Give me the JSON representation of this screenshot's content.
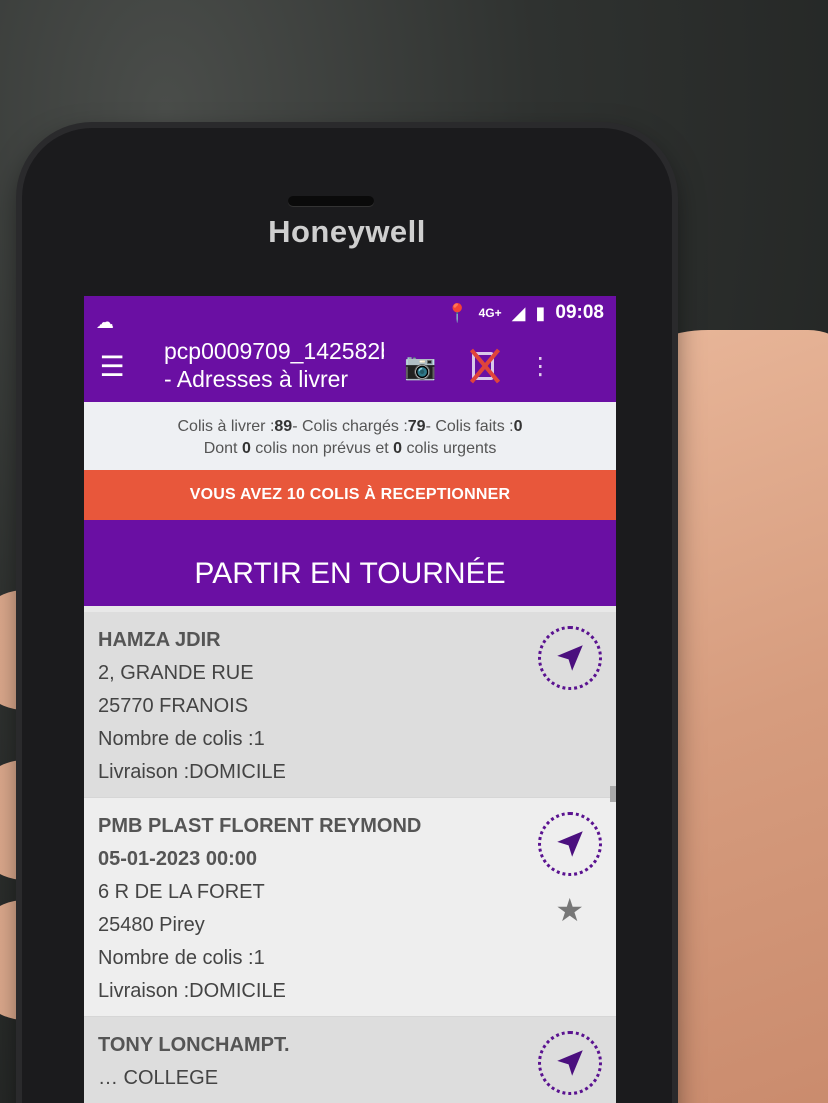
{
  "device": {
    "brand": "Honeywell"
  },
  "statusbar": {
    "network": "4G+",
    "time": "09:08"
  },
  "appbar": {
    "title": "pcp0009709_142582b - Adresses à livrer"
  },
  "summary": {
    "colis_a_livrer_label": "Colis à livrer :",
    "colis_a_livrer": "89",
    "colis_charges_label": "- Colis chargés :",
    "colis_charges": "79",
    "colis_faits_label": "- Colis faits :",
    "colis_faits": "0",
    "dont_label": "Dont ",
    "non_prevus": "0",
    "non_prevus_label": " colis non prévus et ",
    "urgents": "0",
    "urgents_label": " colis urgents"
  },
  "alert": {
    "text": "VOUS AVEZ 10 COLIS À RECEPTIONNER"
  },
  "depart_button": {
    "label": "PARTIR EN TOURNÉE"
  },
  "deliveries": [
    {
      "name": "HAMZA JDIR",
      "street": "2, GRANDE RUE",
      "city": "25770 FRANOIS",
      "count": "Nombre de colis :1",
      "delivery": "Livraison :DOMICILE"
    },
    {
      "name": "PMB PLAST FLORENT REYMOND",
      "date": "05-01-2023 00:00",
      "street": "6 R DE LA FORET",
      "city": "25480 Pirey",
      "count": "Nombre de colis :1",
      "delivery": "Livraison :DOMICILE"
    },
    {
      "name": "TONY LONCHAMPT.",
      "street": "… COLLEGE"
    }
  ]
}
